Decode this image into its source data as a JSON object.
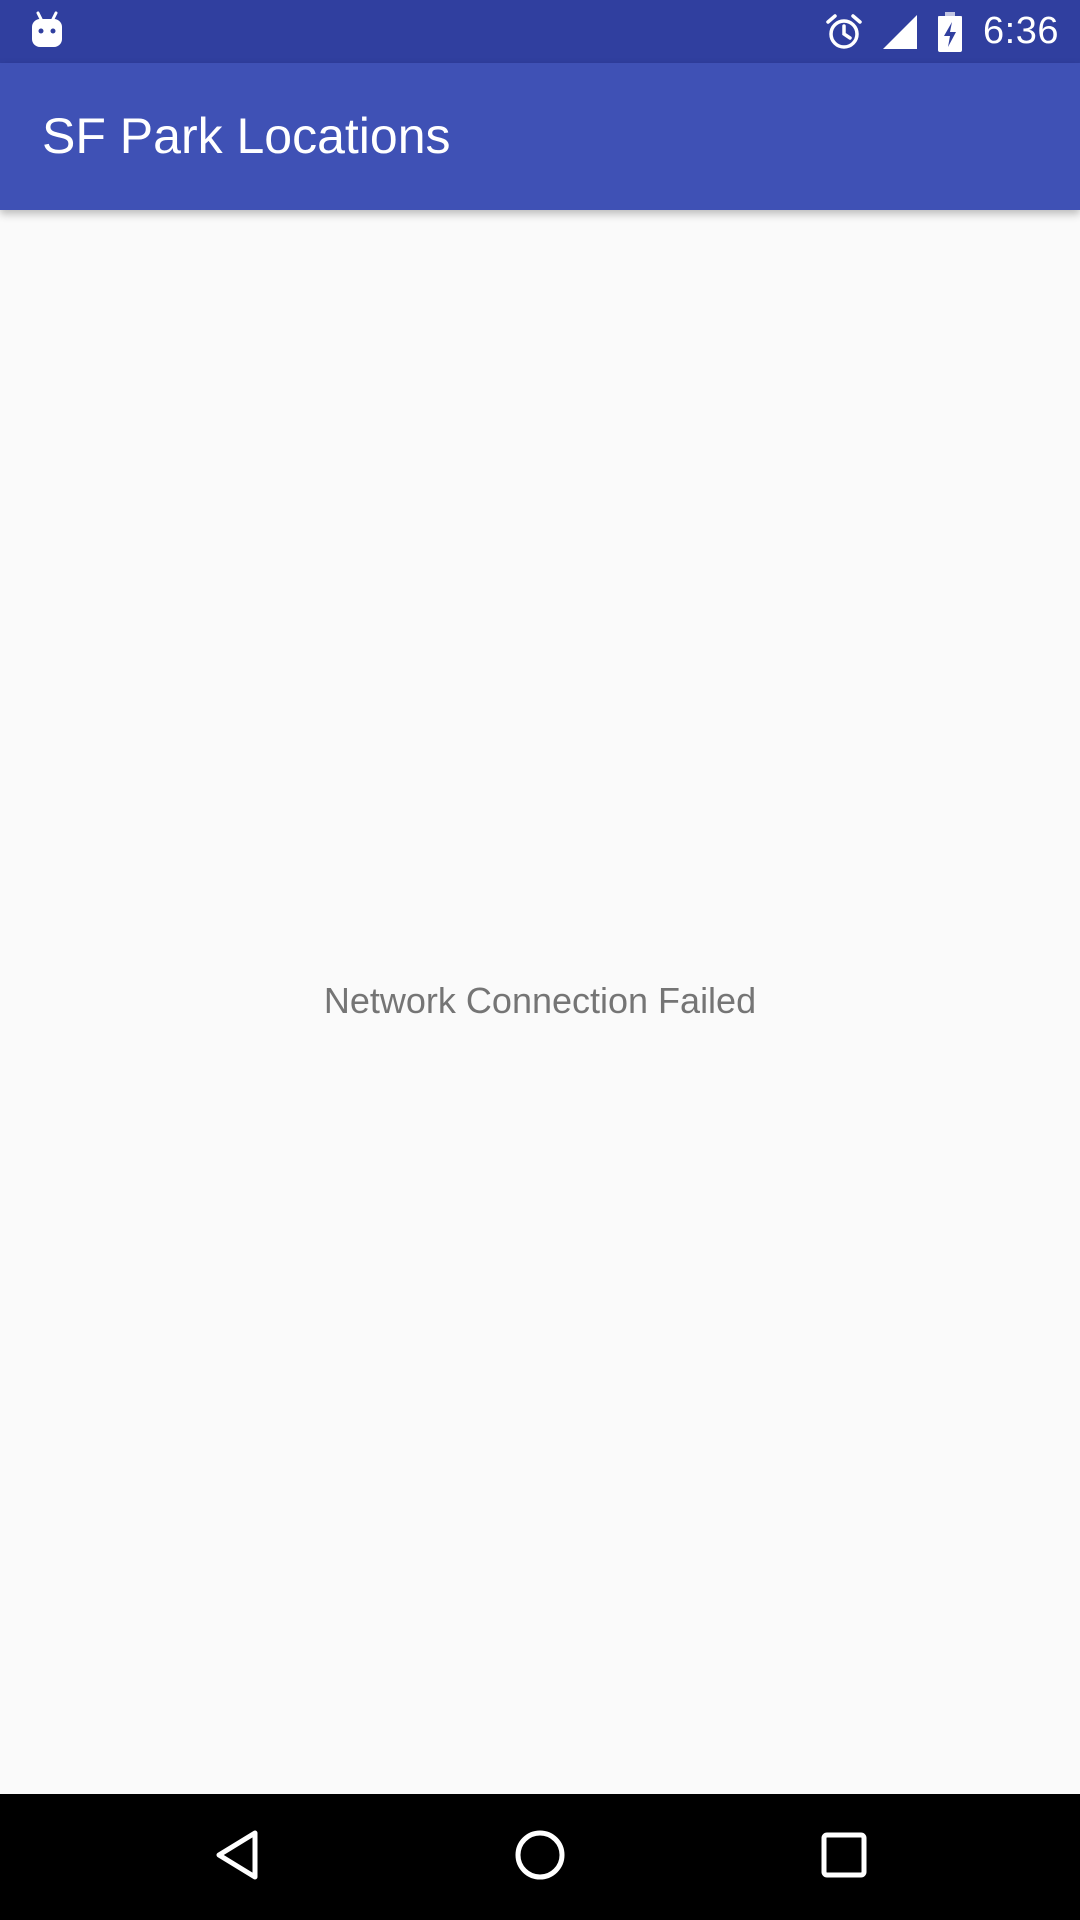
{
  "status_bar": {
    "time": "6:36",
    "icons": [
      "android-icon",
      "alarm-icon",
      "signal-icon",
      "battery-charging-icon"
    ],
    "color": "#303F9F"
  },
  "app_bar": {
    "title": "SF Park Locations",
    "color": "#3F51B5"
  },
  "content": {
    "message": "Network Connection Failed",
    "background": "#FAFAFA"
  },
  "nav_bar": {
    "buttons": [
      "back-icon",
      "home-icon",
      "recents-icon"
    ],
    "color": "#000000"
  }
}
